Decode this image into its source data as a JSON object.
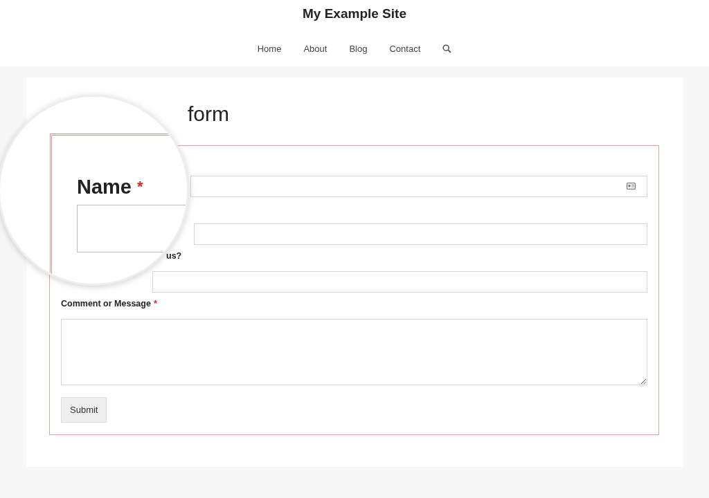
{
  "site": {
    "title": "My Example Site"
  },
  "nav": {
    "items": [
      "Home",
      "About",
      "Blog",
      "Contact"
    ]
  },
  "page": {
    "title": "form"
  },
  "form": {
    "fields": [
      {
        "kind": "text",
        "autofill": true
      },
      {
        "kind": "text",
        "autofill": false
      },
      {
        "kind": "text",
        "autofill": false,
        "label": "us?"
      },
      {
        "kind": "textarea",
        "label": "Comment or Message",
        "required_mark": "*"
      }
    ],
    "submit": "Submit"
  },
  "magnifier": {
    "label": "Name",
    "required_mark": "*"
  }
}
